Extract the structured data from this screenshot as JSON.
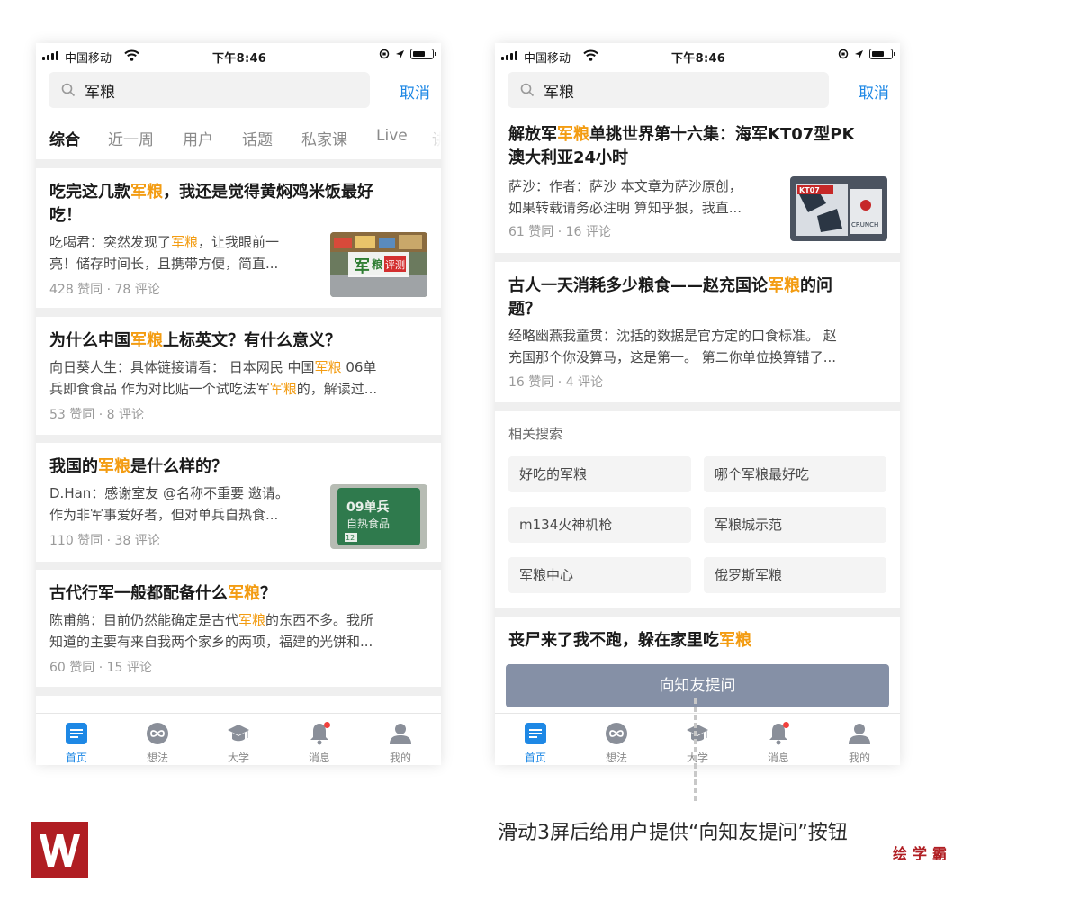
{
  "status_bar": {
    "carrier": "中国移动",
    "time": "下午8:46"
  },
  "search": {
    "query": "军粮",
    "cancel_label": "取消"
  },
  "tabs": [
    "综合",
    "近一周",
    "用户",
    "话题",
    "私家课",
    "Live",
    "讲"
  ],
  "left_feed": [
    {
      "title_parts": [
        "吃完这几款",
        "军粮",
        "，我还是觉得黄焖鸡米饭最好"
      ],
      "title_line2": "吃！",
      "excerpt": [
        [
          "吃喝君：突然发现了",
          "军粮",
          "，让我眼前一"
        ],
        [
          "亮！储存时间长，且携带方便，简直..."
        ]
      ],
      "meta": "428 赞同 · 78 评论",
      "thumb_text": [
        "军",
        "粮",
        "评测"
      ]
    },
    {
      "title_parts": [
        "为什么中国",
        "军粮",
        "上标英文？有什么意义？"
      ],
      "excerpt": [
        [
          "向日葵人生：具体链接请看： 日本网民 中国",
          "军粮",
          " 06单"
        ],
        [
          "兵即食食品 作为对比贴一个试吃法军",
          "军粮",
          "的，解读过..."
        ]
      ],
      "meta": "53 赞同 · 8 评论"
    },
    {
      "title_parts": [
        "我国的",
        "军粮",
        "是什么样的？"
      ],
      "excerpt": [
        [
          "D.Han：感谢室友 @名称不重要 邀请。"
        ],
        [
          "作为非军事爱好者，但对单兵自热食..."
        ]
      ],
      "meta": "110 赞同 · 38 评论",
      "thumb_text": [
        "09单兵",
        "自热食品",
        "12"
      ]
    },
    {
      "title_parts": [
        "古代行军一般都配备什么",
        "军粮",
        "？"
      ],
      "excerpt": [
        [
          "陈甫鸼：目前仍然能确定是古代",
          "军粮",
          "的东西不多。我所"
        ],
        [
          "知道的主要有来自我两个家乡的两项，福建的光饼和..."
        ]
      ],
      "meta": "60 赞同 · 15 评论"
    }
  ],
  "right_feed": [
    {
      "title_line1": [
        "解放军",
        "军粮",
        "单挑世界第十六集：海军KT07型PK"
      ],
      "title_line2": "澳大利亚24小时",
      "excerpt": [
        [
          "萨沙：作者：萨沙 本文章为萨沙原创，"
        ],
        [
          "如果转载请务必注明 算知乎狠，我直..."
        ]
      ],
      "meta": "61 赞同 · 16 评论",
      "thumb_text": [
        "KT07",
        "CRUNCH"
      ]
    },
    {
      "title_line1": [
        "古人一天消耗多少粮食——赵充国论",
        "军粮",
        "的问"
      ],
      "title_line2": "题？",
      "excerpt": [
        [
          "经略幽燕我童贯：沈括的数据是官方定的口食标准。 赵"
        ],
        [
          "充国那个你没算马，这是第一。 第二你单位换算错了..."
        ]
      ],
      "meta": "16 赞同 · 4 评论"
    }
  ],
  "related": {
    "title": "相关搜索",
    "items": [
      "好吃的军粮",
      "哪个军粮最好吃",
      "m134火神机枪",
      "军粮城示范",
      "军粮中心",
      "俄罗斯军粮"
    ]
  },
  "last_item": {
    "title_parts": [
      "丧尸来了我不跑，躲在家里吃",
      "军粮"
    ]
  },
  "ask_button": "向知友提问",
  "bottom_nav": [
    {
      "label": "首页",
      "icon": "home-icon"
    },
    {
      "label": "想法",
      "icon": "ideas-icon"
    },
    {
      "label": "大学",
      "icon": "graduation-cap-icon"
    },
    {
      "label": "消息",
      "icon": "bell-icon"
    },
    {
      "label": "我的",
      "icon": "profile-icon"
    }
  ],
  "caption": "滑动3屏后给用户提供“向知友提问”按钮",
  "brand": "绘学霸",
  "colors": {
    "highlight": "#f39c12",
    "accent": "#1e88e5",
    "ask_button": "#8590a6",
    "brand": "#b01e23"
  }
}
